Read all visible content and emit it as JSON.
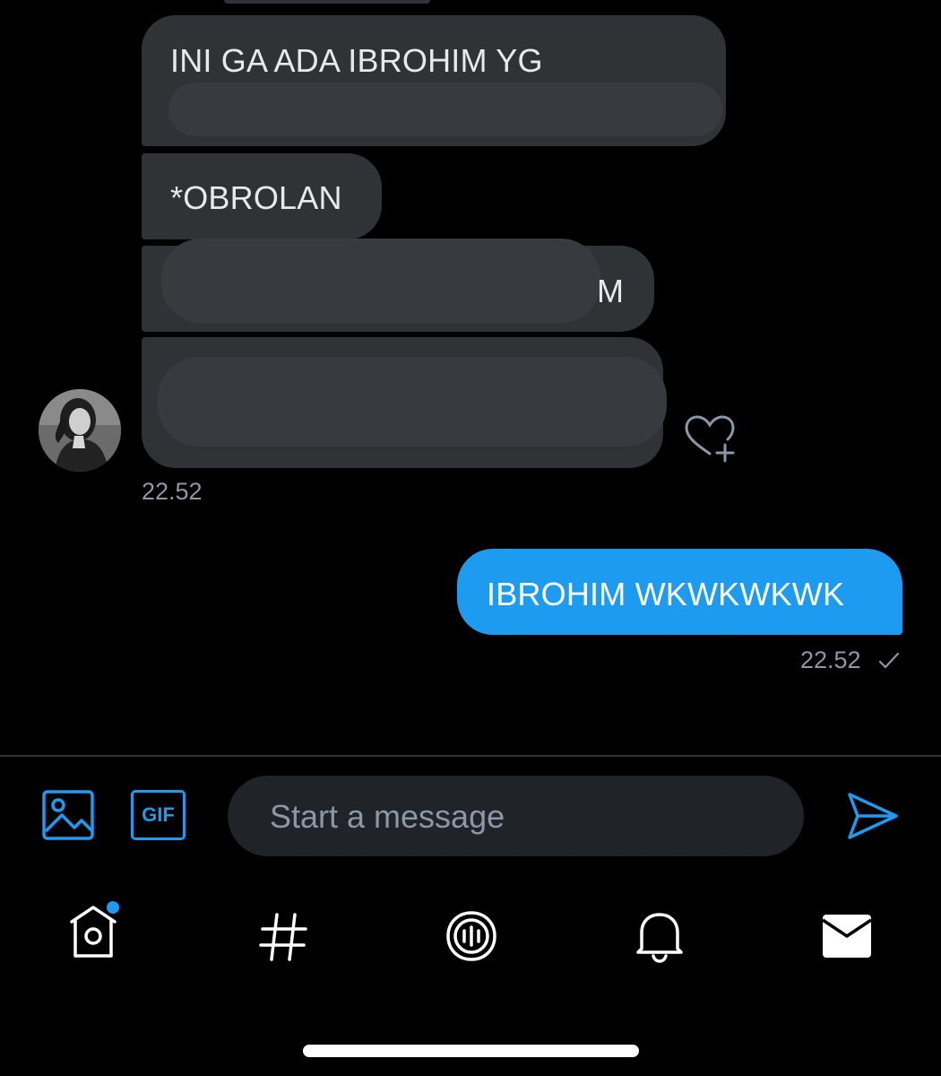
{
  "conversation": {
    "incoming": {
      "messages": [
        {
          "text": "INI GA ADA IBROHIM YG"
        },
        {
          "text": "*OBROLAN"
        },
        {
          "text": "M"
        }
      ],
      "timestamp": "22.52",
      "avatar_icon": "contact-avatar",
      "react_icon": "heart-plus-icon"
    },
    "outgoing": {
      "messages": [
        {
          "text": "IBROHIM WKWKWKWK"
        }
      ],
      "timestamp": "22.52",
      "status_icon": "checkmark-icon"
    }
  },
  "composer": {
    "placeholder": "Start a message",
    "media_icon": "image-icon",
    "gif_label": "GIF",
    "send_icon": "send-icon"
  },
  "tabbar": {
    "items": [
      {
        "icon": "home-icon",
        "has_notification_dot": true
      },
      {
        "icon": "hashtag-icon"
      },
      {
        "icon": "spaces-icon"
      },
      {
        "icon": "bell-icon"
      },
      {
        "icon": "mail-icon",
        "active": true
      }
    ]
  },
  "colors": {
    "background": "#000000",
    "accent": "#1d9bf0",
    "incoming_bubble": "#2f3336",
    "muted_text": "#8b98a5"
  }
}
